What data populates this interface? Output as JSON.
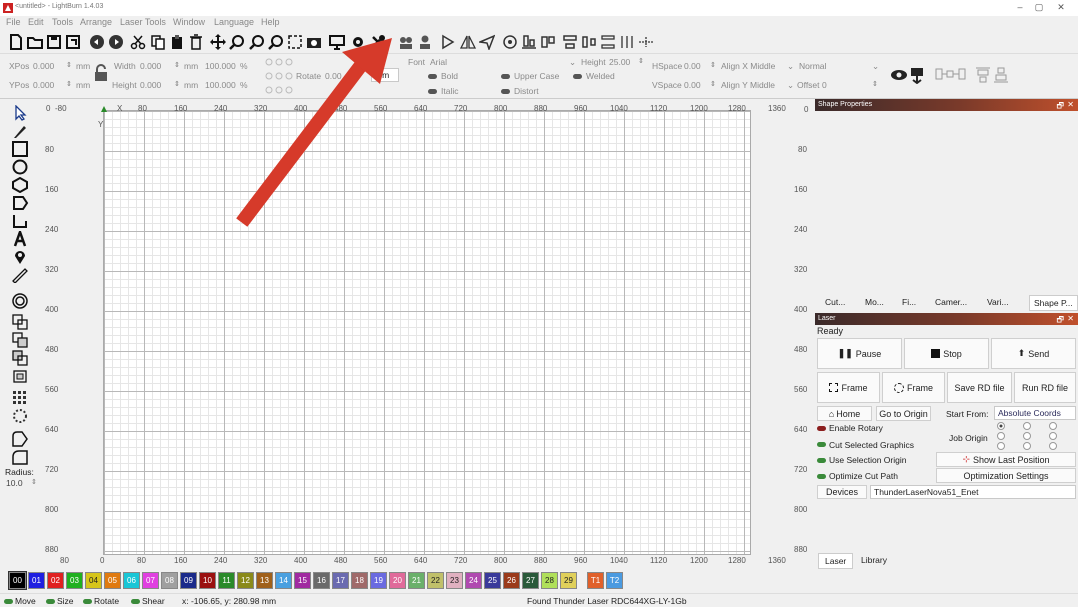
{
  "window": {
    "title": "<untitled> - LightBurn 1.4.03",
    "min": "–",
    "max": "▢",
    "close": "✕"
  },
  "menu": [
    "File",
    "Edit",
    "Tools",
    "Arrange",
    "Laser Tools",
    "Window",
    "Language",
    "Help"
  ],
  "props": {
    "xpos_label": "XPos",
    "xpos_value": "0.000",
    "ypos_label": "YPos",
    "ypos_value": "0.000",
    "unit": "mm",
    "width_label": "Width",
    "width_value": "0.000",
    "height_label": "Height",
    "height_value": "0.000",
    "pct_w": "100.000",
    "pct_h": "100.000",
    "pct": "%",
    "rotate_label": "Rotate",
    "rotate_value": "0.00",
    "rotate_unit": "mm",
    "font_label": "Font",
    "font_value": "Arial",
    "height_font_label": "Height",
    "height_font_value": "25.00",
    "bold": "Bold",
    "italic": "Italic",
    "upper_case": "Upper Case",
    "distort": "Distort",
    "welded": "Welded",
    "hspace_label": "HSpace",
    "hspace_value": "0.00",
    "vspace_label": "VSpace",
    "vspace_value": "0.00",
    "align_x": "Align X Middle",
    "align_y": "Align Y Middle",
    "normal": "Normal",
    "offset_label": "Offset",
    "offset_value": "0"
  },
  "ruler": {
    "top": [
      "0",
      "-80",
      "X",
      "80",
      "160",
      "240",
      "320",
      "400",
      "480",
      "560",
      "640",
      "720",
      "800",
      "880",
      "960",
      "1040",
      "1120",
      "1200",
      "1280",
      "1360"
    ],
    "bottom": [
      "80",
      "0",
      "80",
      "160",
      "240",
      "320",
      "400",
      "480",
      "560",
      "640",
      "720",
      "800",
      "880",
      "960",
      "1040",
      "1120",
      "1200",
      "1280",
      "1360"
    ],
    "left": [
      "80",
      "160",
      "240",
      "320",
      "400",
      "480",
      "560",
      "640",
      "720",
      "800",
      "880"
    ],
    "right": [
      "0",
      "80",
      "160",
      "240",
      "320",
      "400",
      "480",
      "560",
      "640",
      "720",
      "800",
      "880"
    ],
    "y_label": "Y"
  },
  "left_tools": {
    "radius_label": "Radius:",
    "radius_value": "10.0"
  },
  "shape_panel": {
    "title": "Shape Properties",
    "float": "🗗",
    "close": "✕",
    "tabs": [
      "Cut...",
      "Mo...",
      "Fi...",
      "Camer...",
      "Vari...",
      "Shape P..."
    ]
  },
  "laser_panel": {
    "title": "Laser",
    "status": "Ready",
    "pause": "Pause",
    "stop": "Stop",
    "send": "Send",
    "frame1": "Frame",
    "frame2": "Frame",
    "save_rd": "Save RD file",
    "run_rd": "Run RD file",
    "home": "Home",
    "go_origin": "Go to Origin",
    "start_from_label": "Start From:",
    "start_from_value": "Absolute Coords",
    "enable_rotary": "Enable Rotary",
    "job_origin": "Job Origin",
    "cut_selected": "Cut Selected Graphics",
    "use_selection_origin": "Use Selection Origin",
    "show_last_position": "Show Last Position",
    "optimize_cut_path": "Optimize Cut Path",
    "optimization_settings": "Optimization Settings",
    "devices": "Devices",
    "device_value": "ThunderLaserNova51_Enet",
    "bottom_tabs": [
      "Laser",
      "Library"
    ]
  },
  "palette": [
    {
      "label": "00",
      "color": "#000000"
    },
    {
      "label": "01",
      "color": "#1f1fe0"
    },
    {
      "label": "02",
      "color": "#e02020"
    },
    {
      "label": "03",
      "color": "#20b020"
    },
    {
      "label": "04",
      "color": "#d6c51b"
    },
    {
      "label": "05",
      "color": "#e07a10"
    },
    {
      "label": "06",
      "color": "#19c6d6"
    },
    {
      "label": "07",
      "color": "#e040e0"
    },
    {
      "label": "08",
      "color": "#a0a0a0"
    },
    {
      "label": "09",
      "color": "#1a2a8a"
    },
    {
      "label": "10",
      "color": "#9a1010"
    },
    {
      "label": "11",
      "color": "#2a8a2a"
    },
    {
      "label": "12",
      "color": "#8a8a1a"
    },
    {
      "label": "13",
      "color": "#a0601a"
    },
    {
      "label": "14",
      "color": "#4aa0e0"
    },
    {
      "label": "15",
      "color": "#a02aa0"
    },
    {
      "label": "16",
      "color": "#6a6a6a"
    },
    {
      "label": "17",
      "color": "#6a6ab0"
    },
    {
      "label": "18",
      "color": "#a06a6a"
    },
    {
      "label": "19",
      "color": "#6a6ae0"
    },
    {
      "label": "20",
      "color": "#e06a9a"
    },
    {
      "label": "21",
      "color": "#6ab06a"
    },
    {
      "label": "22",
      "color": "#c0c06a"
    },
    {
      "label": "23",
      "color": "#e0b0c0"
    },
    {
      "label": "24",
      "color": "#b04ab0"
    },
    {
      "label": "25",
      "color": "#3a3a9a"
    },
    {
      "label": "26",
      "color": "#9a3a1a"
    },
    {
      "label": "27",
      "color": "#2a5a3a"
    },
    {
      "label": "28",
      "color": "#b0e05a"
    },
    {
      "label": "29",
      "color": "#e0d05a"
    },
    {
      "label": "T1",
      "color": "#e0602a"
    },
    {
      "label": "T2",
      "color": "#4a9ae0"
    }
  ],
  "status": {
    "move": "Move",
    "size": "Size",
    "rotate": "Rotate",
    "shear": "Shear",
    "coords": "x: -106.65, y: 280.98 mm",
    "found": "Found Thunder Laser RDC644XG-LY-1Gb"
  },
  "colors": {
    "arrow": "#d63a2a",
    "panel_header_start": "#3a2a2a",
    "panel_header_end": "#c0502c"
  }
}
